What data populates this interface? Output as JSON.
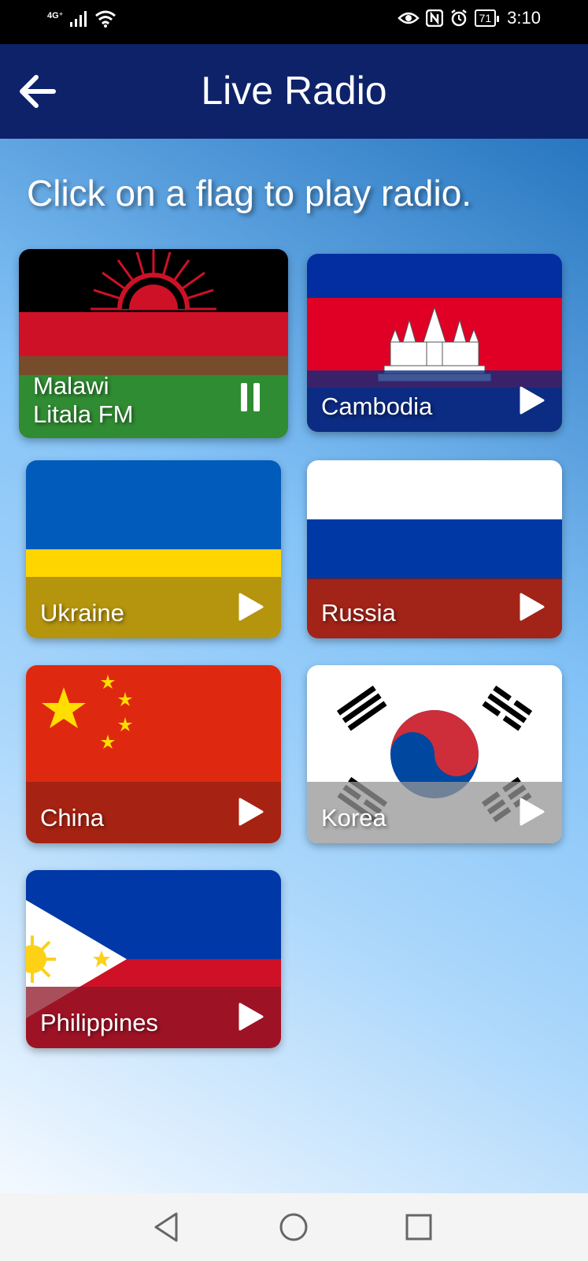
{
  "status_bar": {
    "network": "4G⁺",
    "battery": "71",
    "time": "3:10"
  },
  "app_bar": {
    "title": "Live Radio"
  },
  "prompt": "Click on a flag to play radio.",
  "stations": [
    {
      "label": "Malawi\nLitala FM",
      "country": "Malawi",
      "state": "playing",
      "control_icon": "pause-icon",
      "overlay_color": "#2e7d32"
    },
    {
      "label": "Cambodia",
      "country": "Cambodia",
      "state": "stopped",
      "control_icon": "play-icon",
      "overlay_color": "#0f2a7a"
    },
    {
      "label": "Ukraine",
      "country": "Ukraine",
      "state": "stopped",
      "control_icon": "play-icon",
      "overlay_color": "#a8920c"
    },
    {
      "label": "Russia",
      "country": "Russia",
      "state": "stopped",
      "control_icon": "play-icon",
      "overlay_color": "#8d2419"
    },
    {
      "label": "China",
      "country": "China",
      "state": "stopped",
      "control_icon": "play-icon",
      "overlay_color": "#9a2214"
    },
    {
      "label": "Korea",
      "country": "Korea",
      "state": "stopped",
      "control_icon": "play-icon",
      "overlay_color": "#b3b3b3"
    },
    {
      "label": "Philippines",
      "country": "Philippines",
      "state": "stopped",
      "control_icon": "play-icon",
      "overlay_color": "#8c1426"
    }
  ],
  "nav_bar": {
    "buttons": [
      "back-nav-icon",
      "home-nav-icon",
      "recents-nav-icon"
    ]
  }
}
